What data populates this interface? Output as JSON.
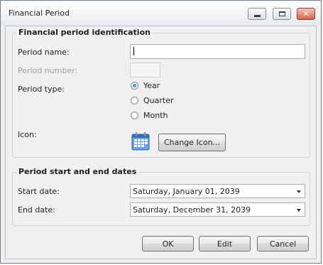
{
  "window": {
    "title": "Financial Period"
  },
  "identification": {
    "group_title": "Financial period identification",
    "period_name_label": "Period name:",
    "period_name_value": "",
    "period_number_label": "Period number:",
    "period_number_value": "",
    "period_type_label": "Period type:",
    "period_types": [
      {
        "label": "Year",
        "selected": true
      },
      {
        "label": "Quarter",
        "selected": false
      },
      {
        "label": "Month",
        "selected": false
      }
    ],
    "icon_label": "Icon:",
    "change_icon_label": "Change Icon..."
  },
  "dates": {
    "group_title": "Period start and end dates",
    "start_label": "Start date:",
    "start_value": "Saturday, January 01, 2039",
    "end_label": "End date:",
    "end_value": "Saturday, December 31, 2039"
  },
  "buttons": {
    "ok": "OK",
    "edit": "Edit",
    "cancel": "Cancel"
  }
}
